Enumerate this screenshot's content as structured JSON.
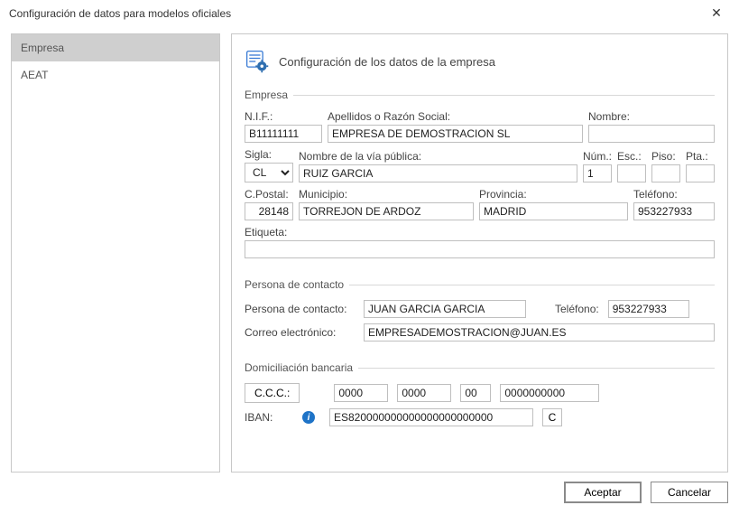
{
  "window": {
    "title": "Configuración de datos para modelos oficiales"
  },
  "sidebar": {
    "items": [
      {
        "label": "Empresa",
        "selected": true
      },
      {
        "label": "AEAT",
        "selected": false
      }
    ]
  },
  "panel": {
    "header": "Configuración de los datos de la empresa"
  },
  "sections": {
    "empresa": {
      "legend": "Empresa",
      "labels": {
        "nif": "N.I.F.:",
        "apellidos": "Apellidos o Razón Social:",
        "nombre": "Nombre:",
        "sigla": "Sigla:",
        "via": "Nombre de la vía pública:",
        "num": "Núm.:",
        "esc": "Esc.:",
        "piso": "Piso:",
        "pta": "Pta.:",
        "cpostal": "C.Postal:",
        "municipio": "Municipio:",
        "provincia": "Provincia:",
        "telefono": "Teléfono:",
        "etiqueta": "Etiqueta:"
      },
      "values": {
        "nif": "B11111111",
        "apellidos": "EMPRESA DE DEMOSTRACION SL",
        "nombre": "",
        "sigla": "CL",
        "via": "RUIZ GARCIA",
        "num": "1",
        "esc": "",
        "piso": "",
        "pta": "",
        "cpostal": "28148",
        "municipio": "TORREJON DE ARDOZ",
        "provincia": "MADRID",
        "telefono": "953227933",
        "etiqueta": ""
      }
    },
    "contacto": {
      "legend": "Persona de contacto",
      "labels": {
        "persona": "Persona de contacto:",
        "telefono": "Teléfono:",
        "correo": "Correo electrónico:"
      },
      "values": {
        "persona": "JUAN GARCIA GARCIA",
        "telefono": "953227933",
        "correo": "EMPRESADEMOSTRACION@JUAN.ES"
      }
    },
    "banco": {
      "legend": "Domiciliación bancaria",
      "labels": {
        "ccc": "C.C.C.:",
        "iban": "IBAN:",
        "calc": "C"
      },
      "values": {
        "ccc1": "0000",
        "ccc2": "0000",
        "ccc3": "00",
        "ccc4": "0000000000",
        "iban": "ES820000000000000000000000"
      }
    }
  },
  "buttons": {
    "accept": "Aceptar",
    "cancel": "Cancelar"
  }
}
